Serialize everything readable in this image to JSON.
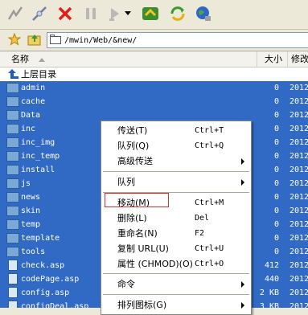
{
  "toolbar": {
    "buttons": [
      {
        "name": "connect-icon"
      },
      {
        "name": "disconnect-icon"
      },
      {
        "name": "stop-icon"
      },
      {
        "name": "pause-icon"
      },
      {
        "name": "queue-icon"
      },
      {
        "name": "dropdown-arrow-icon"
      },
      {
        "name": "sync-icon"
      },
      {
        "name": "refresh-icon"
      },
      {
        "name": "globe-icon"
      }
    ]
  },
  "address": {
    "path": "/mwin/Web/&new/"
  },
  "columns": {
    "name": "名称",
    "size": "大小",
    "modified": "修改"
  },
  "up_item": {
    "label": "上层目录"
  },
  "rows": [
    {
      "name": "admin",
      "size": "0",
      "mod": "2012",
      "type": "folder"
    },
    {
      "name": "cache",
      "size": "0",
      "mod": "2012",
      "type": "folder"
    },
    {
      "name": "Data",
      "size": "0",
      "mod": "2012",
      "type": "folder"
    },
    {
      "name": "inc",
      "size": "0",
      "mod": "2012",
      "type": "folder"
    },
    {
      "name": "inc_img",
      "size": "0",
      "mod": "2012",
      "type": "folder"
    },
    {
      "name": "inc_temp",
      "size": "0",
      "mod": "2012",
      "type": "folder"
    },
    {
      "name": "install",
      "size": "0",
      "mod": "2012",
      "type": "folder"
    },
    {
      "name": "js",
      "size": "0",
      "mod": "2012",
      "type": "folder"
    },
    {
      "name": "news",
      "size": "0",
      "mod": "2012",
      "type": "folder"
    },
    {
      "name": "skin",
      "size": "0",
      "mod": "2012",
      "type": "folder"
    },
    {
      "name": "temp",
      "size": "0",
      "mod": "2012",
      "type": "folder"
    },
    {
      "name": "template",
      "size": "0",
      "mod": "2012",
      "type": "folder"
    },
    {
      "name": "tools",
      "size": "0",
      "mod": "2012",
      "type": "folder"
    },
    {
      "name": "check.asp",
      "size": "412",
      "mod": "2012",
      "type": "file"
    },
    {
      "name": "codePage.asp",
      "size": "440",
      "mod": "2012",
      "type": "file"
    },
    {
      "name": "config.asp",
      "size": "2 KB",
      "mod": "2012",
      "type": "file"
    },
    {
      "name": "configDeal.asp",
      "size": "3 KB",
      "mod": "2012",
      "type": "file"
    }
  ],
  "context_menu": {
    "items": [
      {
        "label": "传送(T)",
        "key": "Ctrl+T",
        "submenu": false
      },
      {
        "label": "队列(Q)",
        "key": "Ctrl+Q",
        "submenu": false
      },
      {
        "label": "高级传送",
        "key": "",
        "submenu": true
      },
      {
        "label": "队列",
        "key": "",
        "submenu": true
      },
      {
        "label": "移动(M)",
        "key": "Ctrl+M",
        "submenu": false
      },
      {
        "label": "删除(L)",
        "key": "Del",
        "submenu": false
      },
      {
        "label": "重命名(N)",
        "key": "F2",
        "submenu": false
      },
      {
        "label": "复制 URL(U)",
        "key": "Ctrl+U",
        "submenu": false
      },
      {
        "label": "属性 (CHMOD)(O)",
        "key": "Ctrl+O",
        "submenu": false
      },
      {
        "label": "命令",
        "key": "",
        "submenu": true
      },
      {
        "label": "排列图标(G)",
        "key": "",
        "submenu": true
      }
    ]
  },
  "colors": {
    "selection": "#316ac5",
    "highlight_box": "#d0312d"
  }
}
